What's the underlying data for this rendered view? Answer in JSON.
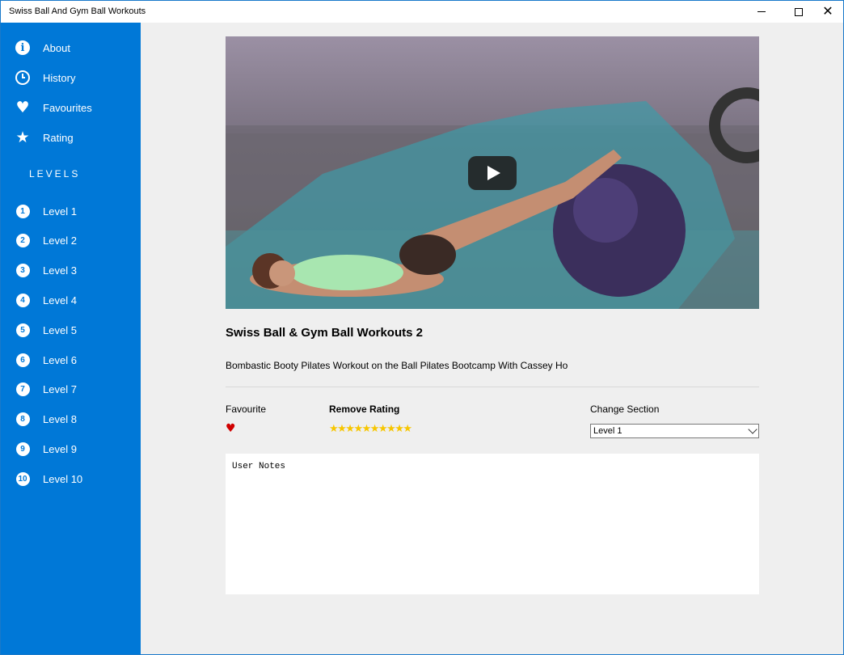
{
  "window": {
    "title": "Swiss Ball And Gym Ball Workouts",
    "minimize_glyph": "—",
    "close_glyph": "✕"
  },
  "sidebar": {
    "menu": [
      {
        "label": "About",
        "icon": "info-icon"
      },
      {
        "label": "History",
        "icon": "clock-icon"
      },
      {
        "label": "Favourites",
        "icon": "heart-icon"
      },
      {
        "label": "Rating",
        "icon": "star-icon"
      }
    ],
    "levels_heading": "LEVELS",
    "levels": [
      {
        "num": "1",
        "label": "Level 1"
      },
      {
        "num": "2",
        "label": "Level 2"
      },
      {
        "num": "3",
        "label": "Level 3"
      },
      {
        "num": "4",
        "label": "Level 4"
      },
      {
        "num": "5",
        "label": "Level 5"
      },
      {
        "num": "6",
        "label": "Level 6"
      },
      {
        "num": "7",
        "label": "Level 7"
      },
      {
        "num": "8",
        "label": "Level 8"
      },
      {
        "num": "9",
        "label": "Level 9"
      },
      {
        "num": "10",
        "label": "Level 10"
      }
    ],
    "colors": {
      "background": "#0078d7",
      "text": "#ffffff"
    }
  },
  "main": {
    "video": {
      "play_icon": "play-icon"
    },
    "title": "Swiss Ball & Gym Ball Workouts 2",
    "description": "Bombastic Booty Pilates Workout on the Ball Pilates Bootcamp With Cassey Ho",
    "favourite": {
      "label": "Favourite",
      "icon": "heart-icon",
      "color": "#d00000"
    },
    "rating": {
      "label": "Remove Rating",
      "stars": "★★★★★★★★★★",
      "count": 10,
      "color": "#f7c600"
    },
    "section": {
      "label": "Change Section",
      "selected": "Level 1"
    },
    "notes": {
      "placeholder": "User Notes"
    }
  }
}
